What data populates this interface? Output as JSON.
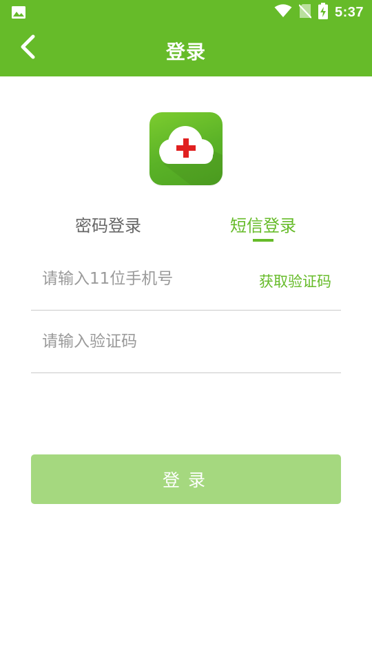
{
  "status_bar": {
    "time": "5:37",
    "icons": [
      "image-icon",
      "wifi-icon",
      "no-sim-icon",
      "battery-charging-icon"
    ]
  },
  "app_bar": {
    "title": "登录",
    "back_icon": "back-arrow-icon"
  },
  "logo": {
    "icon": "cloud-medical-cross-logo"
  },
  "tabs": [
    {
      "label": "密码登录",
      "active": false
    },
    {
      "label": "短信登录",
      "active": true
    }
  ],
  "form": {
    "phone_placeholder": "请输入11位手机号",
    "phone_value": "",
    "get_code_label": "获取验证码",
    "code_placeholder": "请输入验证码",
    "code_value": "",
    "submit_label": "登录"
  },
  "colors": {
    "brand_green": "#66bb29",
    "button_disabled_green": "#a5d87f",
    "cross_red": "#e02020"
  }
}
